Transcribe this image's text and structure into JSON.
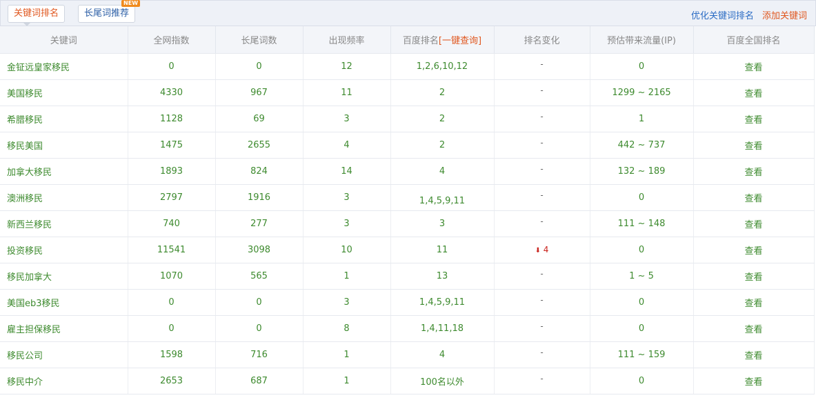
{
  "tabs": {
    "active": "关键词排名",
    "second": "长尾词推荐",
    "second_badge": "NEW"
  },
  "links": {
    "optimize": "优化关键词排名",
    "add": "添加关键词"
  },
  "headers": {
    "keyword": "关键词",
    "index": "全网指数",
    "longtail": "长尾词数",
    "freq": "出现频率",
    "baidu_rank": "百度排名",
    "baidu_rank_link": "[一键查询]",
    "rank_change": "排名变化",
    "traffic": "预估带来流量(IP)",
    "national": "百度全国排名"
  },
  "rows": [
    {
      "keyword": "金钲远皇家移民",
      "index": "0",
      "longtail": "0",
      "freq": "12",
      "rank": "1,2,6,10,12",
      "change": "-",
      "traffic": "0",
      "national": "查看"
    },
    {
      "keyword": "美国移民",
      "index": "4330",
      "longtail": "967",
      "freq": "11",
      "rank": "2",
      "change": "-",
      "traffic": "1299 ~ 2165",
      "national": "查看"
    },
    {
      "keyword": "希腊移民",
      "index": "1128",
      "longtail": "69",
      "freq": "3",
      "rank": "2",
      "change": "-",
      "traffic": "1",
      "national": "查看"
    },
    {
      "keyword": "移民美国",
      "index": "1475",
      "longtail": "2655",
      "freq": "4",
      "rank": "2",
      "change": "-",
      "traffic": "442 ~ 737",
      "national": "查看"
    },
    {
      "keyword": "加拿大移民",
      "index": "1893",
      "longtail": "824",
      "freq": "14",
      "rank": "4",
      "change": "-",
      "traffic": "132 ~ 189",
      "national": "查看"
    },
    {
      "keyword": "澳洲移民",
      "index": "2797",
      "longtail": "1916",
      "freq": "3",
      "rank": "1,4,5,9,11",
      "change": "-",
      "traffic": "0",
      "national": "查看"
    },
    {
      "keyword": "新西兰移民",
      "index": "740",
      "longtail": "277",
      "freq": "3",
      "rank": "3",
      "change": "-",
      "traffic": "111 ~ 148",
      "national": "查看"
    },
    {
      "keyword": "投资移民",
      "index": "11541",
      "longtail": "3098",
      "freq": "10",
      "rank": "11",
      "change": "4",
      "traffic": "0",
      "national": "查看"
    },
    {
      "keyword": "移民加拿大",
      "index": "1070",
      "longtail": "565",
      "freq": "1",
      "rank": "13",
      "change": "-",
      "traffic": "1 ~ 5",
      "national": "查看"
    },
    {
      "keyword": "美国eb3移民",
      "index": "0",
      "longtail": "0",
      "freq": "3",
      "rank": "1,4,5,9,11",
      "change": "-",
      "traffic": "0",
      "national": "查看"
    },
    {
      "keyword": "雇主担保移民",
      "index": "0",
      "longtail": "0",
      "freq": "8",
      "rank": "1,4,11,18",
      "change": "-",
      "traffic": "0",
      "national": "查看"
    },
    {
      "keyword": "移民公司",
      "index": "1598",
      "longtail": "716",
      "freq": "1",
      "rank": "4",
      "change": "-",
      "traffic": "111 ~ 159",
      "national": "查看"
    },
    {
      "keyword": "移民中介",
      "index": "2653",
      "longtail": "687",
      "freq": "1",
      "rank": "100名以外",
      "change": "-",
      "traffic": "0",
      "national": "查看"
    }
  ]
}
